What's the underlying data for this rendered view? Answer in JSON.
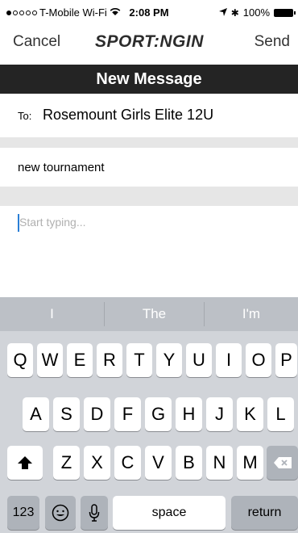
{
  "status_bar": {
    "carrier": "T-Mobile Wi-Fi",
    "time": "2:08 PM",
    "battery": "100%"
  },
  "nav": {
    "cancel_label": "Cancel",
    "send_label": "Send",
    "logo_text": "SPORT:NGIN"
  },
  "title": "New Message",
  "to": {
    "label": "To:",
    "value": "Rosemount Girls Elite 12U"
  },
  "subject": {
    "value": "new tournament"
  },
  "body": {
    "placeholder": "Start typing..."
  },
  "keyboard": {
    "predictions": [
      "I",
      "The",
      "I'm"
    ],
    "row1": [
      "Q",
      "W",
      "E",
      "R",
      "T",
      "Y",
      "U",
      "I",
      "O",
      "P"
    ],
    "row2": [
      "A",
      "S",
      "D",
      "F",
      "G",
      "H",
      "J",
      "K",
      "L"
    ],
    "row3": [
      "Z",
      "X",
      "C",
      "V",
      "B",
      "N",
      "M"
    ],
    "numbers_label": "123",
    "space_label": "space",
    "return_label": "return"
  }
}
